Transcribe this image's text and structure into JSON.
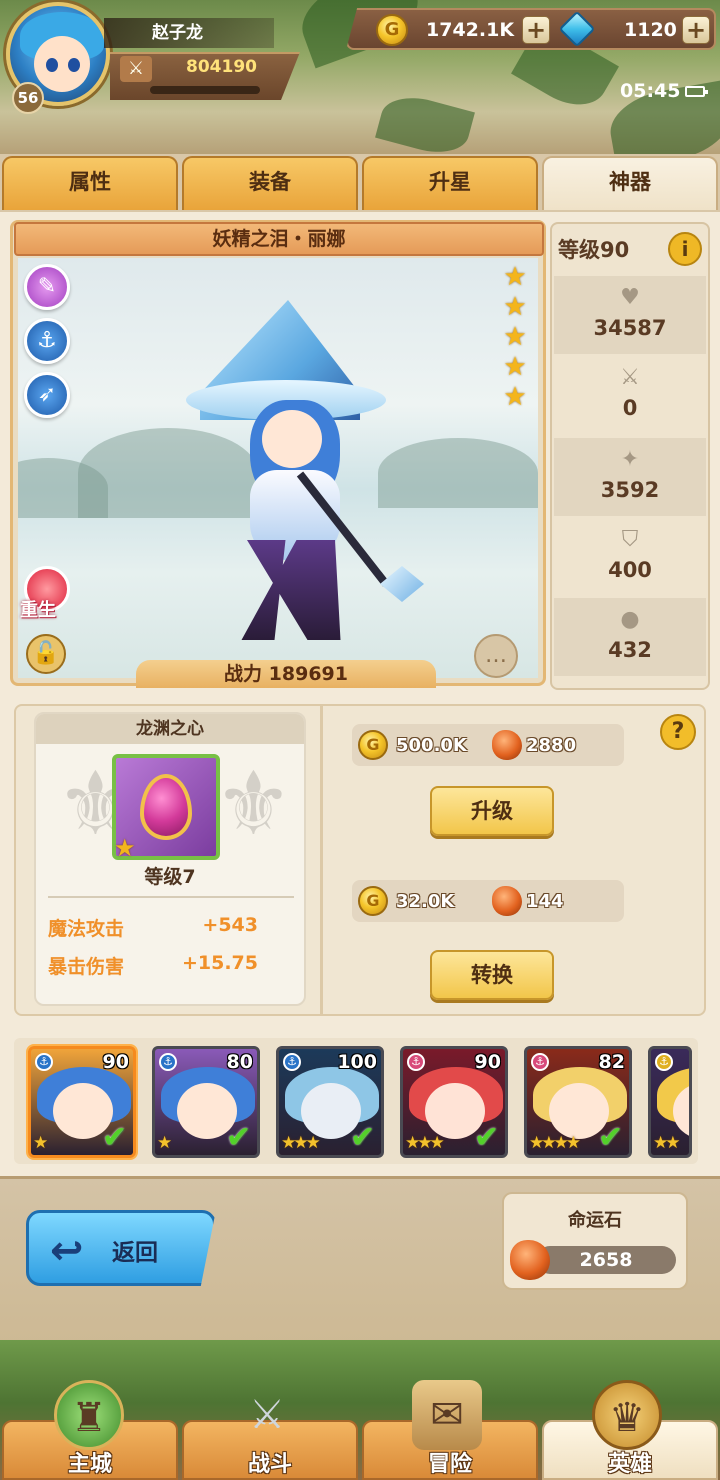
{
  "player": {
    "name": "赵子龙",
    "level": "56",
    "power": "804190"
  },
  "resources": {
    "gold": "1742.1K",
    "gems": "1120"
  },
  "status": {
    "time": "05:45"
  },
  "tabs": [
    {
      "label": "属性",
      "active": false
    },
    {
      "label": "装备",
      "active": false
    },
    {
      "label": "升星",
      "active": false
    },
    {
      "label": "神器",
      "active": true
    }
  ],
  "hero": {
    "title": "妖精之泪・丽娜",
    "stars": 5,
    "combat_label": "战力",
    "combat_value": "189691",
    "rebirth_label": "重生"
  },
  "stats": {
    "level_label": "等级90",
    "values": [
      "34587",
      "0",
      "3592",
      "400",
      "432"
    ],
    "icons": [
      "heart-icon",
      "sword-icon",
      "pierce-icon",
      "shield-icon",
      "drop-icon"
    ]
  },
  "artifact": {
    "name": "龙渊之心",
    "level": "等级7",
    "attributes": [
      {
        "name": "魔法攻击",
        "value": "+543"
      },
      {
        "name": "暴击伤害",
        "value": "+15.75"
      }
    ],
    "upgrade_cost": {
      "gold": "500.0K",
      "stone": "2880"
    },
    "upgrade_label": "升级",
    "convert_cost": {
      "gold": "32.0K",
      "stone": "144"
    },
    "convert_label": "转换"
  },
  "roster": [
    {
      "level": "90",
      "stars": "★",
      "selected": true,
      "colors": {
        "bg": "#f0a43a",
        "hair": "#3f7fd8",
        "face": "#ffe7d6",
        "faction": "#2a74c8"
      }
    },
    {
      "level": "80",
      "stars": "★",
      "selected": false,
      "colors": {
        "bg": "#8a5ab8",
        "hair": "#3f7fd8",
        "face": "#ffe7d6",
        "faction": "#2a74c8"
      }
    },
    {
      "level": "100",
      "stars": "★★★",
      "selected": false,
      "colors": {
        "bg": "#1c3a5a",
        "hair": "#8ec6e6",
        "face": "#e9eef5",
        "faction": "#2a74c8"
      }
    },
    {
      "level": "90",
      "stars": "★★★",
      "selected": false,
      "colors": {
        "bg": "#7a1a2a",
        "hair": "#e24a4a",
        "face": "#ffe3d6",
        "faction": "#d84a7a"
      }
    },
    {
      "level": "82",
      "stars": "★★★★",
      "selected": false,
      "colors": {
        "bg": "#8a2a1a",
        "hair": "#f2d06a",
        "face": "#ffe7d6",
        "faction": "#d84a7a"
      }
    },
    {
      "level": "",
      "stars": "★★",
      "selected": false,
      "colors": {
        "bg": "#3a2a5a",
        "hair": "#f2c94a",
        "face": "#ffe7d6",
        "faction": "#e0b020"
      }
    }
  ],
  "bottom": {
    "back_label": "返回",
    "destiny_title": "命运石",
    "destiny_value": "2658"
  },
  "nav": [
    {
      "label": "主城",
      "icon": "castle-icon",
      "active": false
    },
    {
      "label": "战斗",
      "icon": "crossed-swords-icon",
      "active": false
    },
    {
      "label": "冒险",
      "icon": "scroll-map-icon",
      "active": false
    },
    {
      "label": "英雄",
      "icon": "hero-crest-icon",
      "active": true
    }
  ]
}
